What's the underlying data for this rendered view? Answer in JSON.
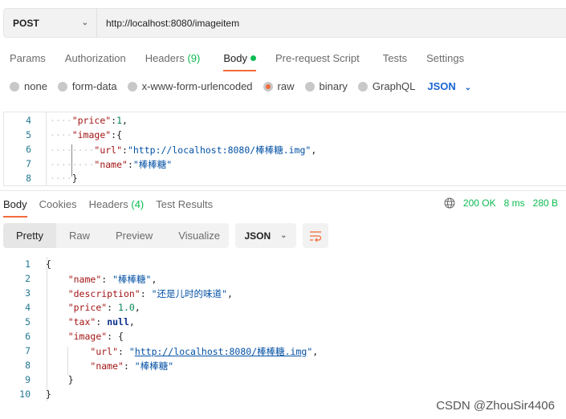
{
  "request": {
    "method": "POST",
    "url": "http://localhost:8080/imageitem"
  },
  "request_tabs": [
    {
      "label": "Params"
    },
    {
      "label": "Authorization"
    },
    {
      "label": "Headers",
      "count": "(9)"
    },
    {
      "label": "Body",
      "active": true,
      "dot": true
    },
    {
      "label": "Pre-request Script"
    },
    {
      "label": "Tests"
    },
    {
      "label": "Settings"
    }
  ],
  "body_types": [
    {
      "label": "none"
    },
    {
      "label": "form-data"
    },
    {
      "label": "x-www-form-urlencoded"
    },
    {
      "label": "raw",
      "selected": true
    },
    {
      "label": "binary"
    },
    {
      "label": "GraphQL"
    }
  ],
  "body_format": "JSON",
  "request_body": [
    {
      "num": "4",
      "tokens": [
        [
          "ws",
          "····"
        ],
        [
          "k",
          "\"price\""
        ],
        [
          "p",
          ":"
        ],
        [
          "n",
          "1"
        ],
        [
          "p",
          ","
        ]
      ]
    },
    {
      "num": "5",
      "tokens": [
        [
          "ws",
          "····"
        ],
        [
          "k",
          "\"image\""
        ],
        [
          "p",
          ":{"
        ]
      ]
    },
    {
      "num": "6",
      "tokens": [
        [
          "ws",
          "········"
        ],
        [
          "k",
          "\"url\""
        ],
        [
          "p",
          ":"
        ],
        [
          "s",
          "\"http://localhost:8080/棒棒糖.img\""
        ],
        [
          "p",
          ","
        ]
      ]
    },
    {
      "num": "7",
      "tokens": [
        [
          "ws",
          "········"
        ],
        [
          "k",
          "\"name\""
        ],
        [
          "p",
          ":"
        ],
        [
          "s",
          "\"棒棒糖\""
        ]
      ]
    },
    {
      "num": "8",
      "tokens": [
        [
          "ws",
          "····"
        ],
        [
          "p",
          "}"
        ]
      ]
    }
  ],
  "response_tabs": [
    {
      "label": "Body",
      "active": true
    },
    {
      "label": "Cookies"
    },
    {
      "label": "Headers",
      "count": "(4)"
    },
    {
      "label": "Test Results"
    }
  ],
  "status": {
    "code": "200 OK",
    "time": "8 ms",
    "size": "280 B",
    "color": "#0cbb52"
  },
  "view_modes": [
    {
      "label": "Pretty",
      "active": true
    },
    {
      "label": "Raw"
    },
    {
      "label": "Preview"
    },
    {
      "label": "Visualize"
    }
  ],
  "response_format": "JSON",
  "response_body": [
    {
      "num": "1",
      "tokens": [
        [
          "p",
          "{"
        ]
      ]
    },
    {
      "num": "2",
      "tokens": [
        [
          "p",
          "    "
        ],
        [
          "k",
          "\"name\""
        ],
        [
          "p",
          ": "
        ],
        [
          "s",
          "\"棒棒糖\""
        ],
        [
          "p",
          ","
        ]
      ]
    },
    {
      "num": "3",
      "tokens": [
        [
          "p",
          "    "
        ],
        [
          "k",
          "\"description\""
        ],
        [
          "p",
          ": "
        ],
        [
          "s",
          "\"还是儿时的味道\""
        ],
        [
          "p",
          ","
        ]
      ]
    },
    {
      "num": "4",
      "tokens": [
        [
          "p",
          "    "
        ],
        [
          "k",
          "\"price\""
        ],
        [
          "p",
          ": "
        ],
        [
          "n",
          "1.0"
        ],
        [
          "p",
          ","
        ]
      ]
    },
    {
      "num": "5",
      "tokens": [
        [
          "p",
          "    "
        ],
        [
          "k",
          "\"tax\""
        ],
        [
          "p",
          ": "
        ],
        [
          "nl",
          "null"
        ],
        [
          "p",
          ","
        ]
      ]
    },
    {
      "num": "6",
      "tokens": [
        [
          "p",
          "    "
        ],
        [
          "k",
          "\"image\""
        ],
        [
          "p",
          ": {"
        ]
      ]
    },
    {
      "num": "7",
      "tokens": [
        [
          "p",
          "        "
        ],
        [
          "k",
          "\"url\""
        ],
        [
          "p",
          ": "
        ],
        [
          "s",
          "\""
        ],
        [
          "s u",
          "http://localhost:8080/棒棒糖.img"
        ],
        [
          "s",
          "\""
        ],
        [
          "p",
          ","
        ]
      ]
    },
    {
      "num": "8",
      "tokens": [
        [
          "p",
          "        "
        ],
        [
          "k",
          "\"name\""
        ],
        [
          "p",
          ": "
        ],
        [
          "s",
          "\"棒棒糖\""
        ]
      ]
    },
    {
      "num": "9",
      "tokens": [
        [
          "p",
          "    }"
        ]
      ]
    },
    {
      "num": "10",
      "tokens": [
        [
          "p",
          "}"
        ]
      ]
    }
  ],
  "watermark": "CSDN @ZhouSir4406"
}
